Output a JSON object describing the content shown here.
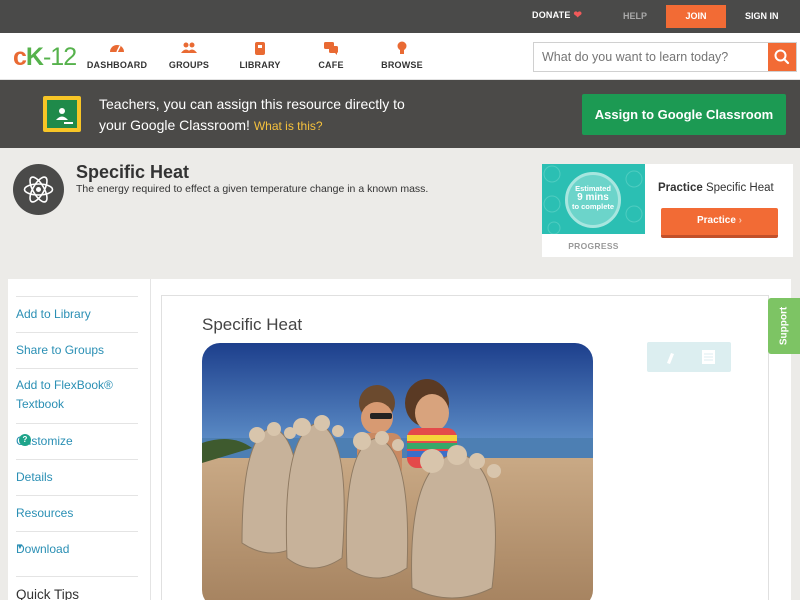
{
  "topbar": {
    "donate": "DONATE",
    "help": "HELP",
    "join": "JOIN",
    "signin": "SIGN IN"
  },
  "logo": {
    "part1": "c",
    "part2": "K",
    "part3": "-12"
  },
  "nav": {
    "items": [
      {
        "label": "DASHBOARD",
        "icon": "dashboard-icon"
      },
      {
        "label": "GROUPS",
        "icon": "groups-icon"
      },
      {
        "label": "LIBRARY",
        "icon": "library-icon"
      },
      {
        "label": "CAFE",
        "icon": "cafe-icon"
      },
      {
        "label": "BROWSE",
        "icon": "browse-icon"
      }
    ],
    "search_placeholder": "What do you want to learn today?"
  },
  "banner": {
    "line1": "Teachers, you can assign this resource directly to",
    "line2": "your Google Classroom!",
    "what_link": "What is this?",
    "assign_button": "Assign to Google Classroom"
  },
  "concept": {
    "title": "Specific Heat",
    "description": "The energy required to effect a given temperature change in a known mass."
  },
  "practice": {
    "estimate_line1": "Estimated",
    "estimate_line2": "9 mins",
    "estimate_line3": "to complete",
    "progress_label": "PROGRESS",
    "title_bold": "Practice",
    "title_rest": "Specific Heat",
    "button": "Practice"
  },
  "sidebar": {
    "items": [
      {
        "label": "Add to Library"
      },
      {
        "label": "Share to Groups"
      },
      {
        "label": "Add to FlexBook® Textbook"
      },
      {
        "label": "Customize"
      },
      {
        "label": "Details"
      },
      {
        "label": "Resources"
      },
      {
        "label": "Download"
      }
    ],
    "quick_tips": "Quick Tips"
  },
  "main": {
    "title": "Specific Heat"
  },
  "support": "Support",
  "colors": {
    "accent_orange": "#f26b35",
    "google_green": "#1c9a53",
    "link_blue": "#2a8fb4",
    "support_green": "#7dc464"
  }
}
